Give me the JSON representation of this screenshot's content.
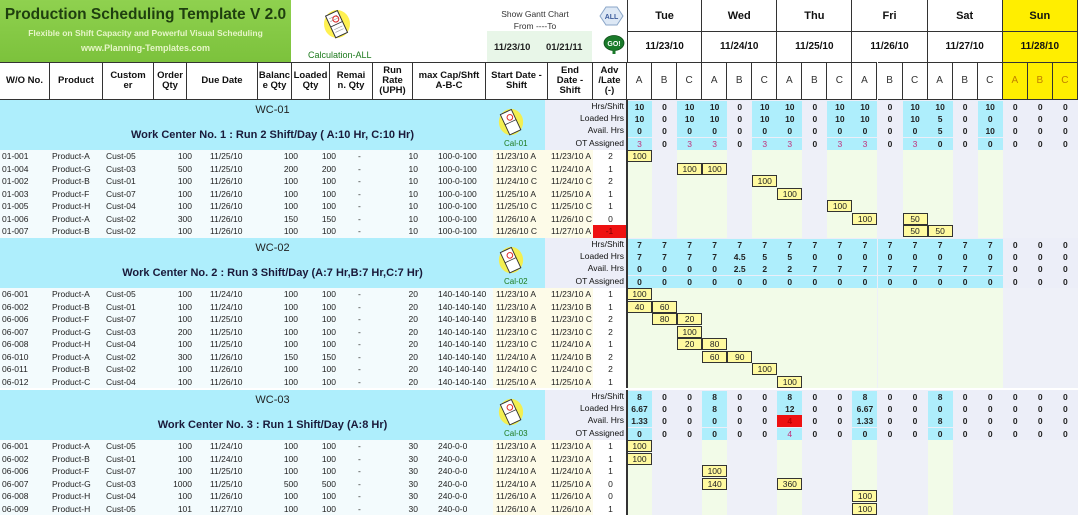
{
  "title": {
    "main": "Production Scheduling Template V 2.0",
    "subtitle": "Flexible on Shift Capacity and Powerful Visual Scheduling",
    "url": "www.Planning-Templates.com"
  },
  "calc_all_label": "Calculation-ALL",
  "gantt": {
    "label_line1": "Show Gantt Chart",
    "label_line2": "From ----To",
    "from": "11/23/10",
    "to": "01/21/11",
    "all_button": "ALL",
    "go_button": "GO!"
  },
  "columns": [
    "W/O No.",
    "Product",
    "Customer",
    "Order Qty",
    "Due Date",
    "Balance Qty",
    "Loaded Qty",
    "Remain. Qty",
    "Run Rate (UPH)",
    "max Cap/Shft A-B-C",
    "Start Date - Shift",
    "End Date - Shift",
    "Adv /Late (-)"
  ],
  "days": [
    {
      "day": "Tue",
      "date": "11/23/10",
      "weekend": false
    },
    {
      "day": "Wed",
      "date": "11/24/10",
      "weekend": false
    },
    {
      "day": "Thu",
      "date": "11/25/10",
      "weekend": false
    },
    {
      "day": "Fri",
      "date": "11/26/10",
      "weekend": false
    },
    {
      "day": "Sat",
      "date": "11/27/10",
      "weekend": false
    },
    {
      "day": "Sun",
      "date": "11/28/10",
      "weekend": true
    }
  ],
  "shifts": [
    "A",
    "B",
    "C"
  ],
  "summary_labels": [
    "Hrs/Shift",
    "Loaded Hrs",
    "Avail. Hrs",
    "OT Assigned"
  ],
  "work_centers": [
    {
      "id": "WC-01",
      "description": "Work Center No. 1 : Run 2 Shift/Day ( A:10 Hr, C:10 Hr)",
      "cal_label": "Cal-01",
      "summary": {
        "hrs_shift": [
          "10",
          "0",
          "10",
          "10",
          "0",
          "10",
          "10",
          "0",
          "10",
          "10",
          "0",
          "10",
          "10",
          "0",
          "10",
          "0",
          "0",
          "0"
        ],
        "loaded_hrs": [
          "10",
          "0",
          "10",
          "10",
          "0",
          "10",
          "10",
          "0",
          "10",
          "10",
          "0",
          "10",
          "5",
          "0",
          "0",
          "0",
          "0",
          "0"
        ],
        "avail_hrs": [
          "0",
          "0",
          "0",
          "0",
          "0",
          "0",
          "0",
          "0",
          "0",
          "0",
          "0",
          "0",
          "5",
          "0",
          "10",
          "0",
          "0",
          "0"
        ],
        "ot_assigned": [
          "3",
          "0",
          "3",
          "3",
          "0",
          "3",
          "3",
          "0",
          "3",
          "3",
          "0",
          "3",
          "0",
          "0",
          "0",
          "0",
          "0",
          "0"
        ]
      },
      "orders": [
        {
          "wo": "01-001",
          "product": "Product-A",
          "customer": "Cust-05",
          "order_qty": "100",
          "due": "11/25/10",
          "balance": "100",
          "loaded": "100",
          "remain": "-",
          "rate": "10",
          "cap": "100-0-100",
          "start": "11/23/10 A",
          "end": "11/23/10 A",
          "adv": "2",
          "late": false,
          "bars": [
            [
              0,
              "100"
            ]
          ]
        },
        {
          "wo": "01-004",
          "product": "Product-G",
          "customer": "Cust-03",
          "order_qty": "500",
          "due": "11/25/10",
          "balance": "200",
          "loaded": "200",
          "remain": "-",
          "rate": "10",
          "cap": "100-0-100",
          "start": "11/23/10 C",
          "end": "11/24/10 A",
          "adv": "1",
          "late": false,
          "bars": [
            [
              2,
              "100"
            ],
            [
              3,
              "100"
            ]
          ]
        },
        {
          "wo": "01-002",
          "product": "Product-B",
          "customer": "Cust-01",
          "order_qty": "100",
          "due": "11/26/10",
          "balance": "100",
          "loaded": "100",
          "remain": "-",
          "rate": "10",
          "cap": "100-0-100",
          "start": "11/24/10 C",
          "end": "11/24/10 C",
          "adv": "2",
          "late": false,
          "bars": [
            [
              5,
              "100"
            ]
          ]
        },
        {
          "wo": "01-003",
          "product": "Product-F",
          "customer": "Cust-07",
          "order_qty": "100",
          "due": "11/26/10",
          "balance": "100",
          "loaded": "100",
          "remain": "-",
          "rate": "10",
          "cap": "100-0-100",
          "start": "11/25/10 A",
          "end": "11/25/10 A",
          "adv": "1",
          "late": false,
          "bars": [
            [
              6,
              "100"
            ]
          ]
        },
        {
          "wo": "01-005",
          "product": "Product-H",
          "customer": "Cust-04",
          "order_qty": "100",
          "due": "11/26/10",
          "balance": "100",
          "loaded": "100",
          "remain": "-",
          "rate": "10",
          "cap": "100-0-100",
          "start": "11/25/10 C",
          "end": "11/25/10 C",
          "adv": "1",
          "late": false,
          "bars": [
            [
              8,
              "100"
            ]
          ]
        },
        {
          "wo": "01-006",
          "product": "Product-A",
          "customer": "Cust-02",
          "order_qty": "300",
          "due": "11/26/10",
          "balance": "150",
          "loaded": "150",
          "remain": "-",
          "rate": "10",
          "cap": "100-0-100",
          "start": "11/26/10 A",
          "end": "11/26/10 C",
          "adv": "0",
          "late": false,
          "bars": [
            [
              9,
              "100"
            ],
            [
              11,
              "50"
            ]
          ]
        },
        {
          "wo": "01-007",
          "product": "Product-B",
          "customer": "Cust-02",
          "order_qty": "100",
          "due": "11/26/10",
          "balance": "100",
          "loaded": "100",
          "remain": "-",
          "rate": "10",
          "cap": "100-0-100",
          "start": "11/26/10 C",
          "end": "11/27/10 A",
          "adv": "-1",
          "late": true,
          "bars": [
            [
              11,
              "50"
            ],
            [
              12,
              "50"
            ]
          ]
        }
      ]
    },
    {
      "id": "WC-02",
      "description": "Work Center No. 2 : Run 3 Shift/Day (A:7 Hr,B:7 Hr,C:7 Hr)",
      "cal_label": "Cal-02",
      "summary": {
        "hrs_shift": [
          "7",
          "7",
          "7",
          "7",
          "7",
          "7",
          "7",
          "7",
          "7",
          "7",
          "7",
          "7",
          "7",
          "7",
          "7",
          "0",
          "0",
          "0"
        ],
        "loaded_hrs": [
          "7",
          "7",
          "7",
          "7",
          "4.5",
          "5",
          "5",
          "0",
          "0",
          "0",
          "0",
          "0",
          "0",
          "0",
          "0",
          "0",
          "0",
          "0"
        ],
        "avail_hrs": [
          "0",
          "0",
          "0",
          "0",
          "2.5",
          "2",
          "2",
          "7",
          "7",
          "7",
          "7",
          "7",
          "7",
          "7",
          "7",
          "0",
          "0",
          "0"
        ],
        "ot_assigned": [
          "0",
          "0",
          "0",
          "0",
          "0",
          "0",
          "0",
          "0",
          "0",
          "0",
          "0",
          "0",
          "0",
          "0",
          "0",
          "0",
          "0",
          "0"
        ]
      },
      "orders": [
        {
          "wo": "06-001",
          "product": "Product-A",
          "customer": "Cust-05",
          "order_qty": "100",
          "due": "11/24/10",
          "balance": "100",
          "loaded": "100",
          "remain": "-",
          "rate": "20",
          "cap": "140-140-140",
          "start": "11/23/10 A",
          "end": "11/23/10 A",
          "adv": "1",
          "late": false,
          "bars": [
            [
              0,
              "100"
            ]
          ]
        },
        {
          "wo": "06-002",
          "product": "Product-B",
          "customer": "Cust-01",
          "order_qty": "100",
          "due": "11/24/10",
          "balance": "100",
          "loaded": "100",
          "remain": "-",
          "rate": "20",
          "cap": "140-140-140",
          "start": "11/23/10 A",
          "end": "11/23/10 B",
          "adv": "1",
          "late": false,
          "bars": [
            [
              0,
              "40"
            ],
            [
              1,
              "60"
            ]
          ]
        },
        {
          "wo": "06-006",
          "product": "Product-F",
          "customer": "Cust-07",
          "order_qty": "100",
          "due": "11/25/10",
          "balance": "100",
          "loaded": "100",
          "remain": "-",
          "rate": "20",
          "cap": "140-140-140",
          "start": "11/23/10 B",
          "end": "11/23/10 C",
          "adv": "2",
          "late": false,
          "bars": [
            [
              1,
              "80"
            ],
            [
              2,
              "20"
            ]
          ]
        },
        {
          "wo": "06-007",
          "product": "Product-G",
          "customer": "Cust-03",
          "order_qty": "200",
          "due": "11/25/10",
          "balance": "100",
          "loaded": "100",
          "remain": "-",
          "rate": "20",
          "cap": "140-140-140",
          "start": "11/23/10 C",
          "end": "11/23/10 C",
          "adv": "2",
          "late": false,
          "bars": [
            [
              2,
              "100"
            ]
          ]
        },
        {
          "wo": "06-008",
          "product": "Product-H",
          "customer": "Cust-04",
          "order_qty": "100",
          "due": "11/25/10",
          "balance": "100",
          "loaded": "100",
          "remain": "-",
          "rate": "20",
          "cap": "140-140-140",
          "start": "11/23/10 C",
          "end": "11/24/10 A",
          "adv": "1",
          "late": false,
          "bars": [
            [
              2,
              "20"
            ],
            [
              3,
              "80"
            ]
          ]
        },
        {
          "wo": "06-010",
          "product": "Product-A",
          "customer": "Cust-02",
          "order_qty": "300",
          "due": "11/26/10",
          "balance": "150",
          "loaded": "150",
          "remain": "-",
          "rate": "20",
          "cap": "140-140-140",
          "start": "11/24/10 A",
          "end": "11/24/10 B",
          "adv": "2",
          "late": false,
          "bars": [
            [
              3,
              "60"
            ],
            [
              4,
              "90"
            ]
          ]
        },
        {
          "wo": "06-011",
          "product": "Product-B",
          "customer": "Cust-02",
          "order_qty": "100",
          "due": "11/26/10",
          "balance": "100",
          "loaded": "100",
          "remain": "-",
          "rate": "20",
          "cap": "140-140-140",
          "start": "11/24/10 C",
          "end": "11/24/10 C",
          "adv": "2",
          "late": false,
          "bars": [
            [
              5,
              "100"
            ]
          ]
        },
        {
          "wo": "06-012",
          "product": "Product-C",
          "customer": "Cust-04",
          "order_qty": "100",
          "due": "11/26/10",
          "balance": "100",
          "loaded": "100",
          "remain": "-",
          "rate": "20",
          "cap": "140-140-140",
          "start": "11/25/10 A",
          "end": "11/25/10 A",
          "adv": "1",
          "late": false,
          "bars": [
            [
              6,
              "100"
            ]
          ]
        }
      ]
    },
    {
      "id": "WC-03",
      "description": "Work Center No. 3 : Run 1 Shift/Day (A:8 Hr)",
      "cal_label": "Cal-03",
      "summary": {
        "hrs_shift": [
          "8",
          "0",
          "0",
          "8",
          "0",
          "0",
          "8",
          "0",
          "0",
          "8",
          "0",
          "0",
          "8",
          "0",
          "0",
          "0",
          "0",
          "0"
        ],
        "loaded_hrs": [
          "6.67",
          "0",
          "0",
          "8",
          "0",
          "0",
          "12",
          "0",
          "0",
          "6.67",
          "0",
          "0",
          "0",
          "0",
          "0",
          "0",
          "0",
          "0"
        ],
        "avail_hrs": [
          "1.33",
          "0",
          "0",
          "0",
          "0",
          "0",
          "-4",
          "0",
          "0",
          "1.33",
          "0",
          "0",
          "8",
          "0",
          "0",
          "0",
          "0",
          "0"
        ],
        "ot_assigned": [
          "0",
          "0",
          "0",
          "0",
          "0",
          "0",
          "4",
          "0",
          "0",
          "0",
          "0",
          "0",
          "0",
          "0",
          "0",
          "0",
          "0",
          "0"
        ]
      },
      "orders": [
        {
          "wo": "06-001",
          "product": "Product-A",
          "customer": "Cust-05",
          "order_qty": "100",
          "due": "11/24/10",
          "balance": "100",
          "loaded": "100",
          "remain": "-",
          "rate": "30",
          "cap": "240-0-0",
          "start": "11/23/10 A",
          "end": "11/23/10 A",
          "adv": "1",
          "late": false,
          "bars": [
            [
              0,
              "100"
            ]
          ]
        },
        {
          "wo": "06-002",
          "product": "Product-B",
          "customer": "Cust-01",
          "order_qty": "100",
          "due": "11/24/10",
          "balance": "100",
          "loaded": "100",
          "remain": "-",
          "rate": "30",
          "cap": "240-0-0",
          "start": "11/23/10 A",
          "end": "11/23/10 A",
          "adv": "1",
          "late": false,
          "bars": [
            [
              0,
              "100"
            ]
          ]
        },
        {
          "wo": "06-006",
          "product": "Product-F",
          "customer": "Cust-07",
          "order_qty": "100",
          "due": "11/25/10",
          "balance": "100",
          "loaded": "100",
          "remain": "-",
          "rate": "30",
          "cap": "240-0-0",
          "start": "11/24/10 A",
          "end": "11/24/10 A",
          "adv": "1",
          "late": false,
          "bars": [
            [
              3,
              "100"
            ]
          ]
        },
        {
          "wo": "06-007",
          "product": "Product-G",
          "customer": "Cust-03",
          "order_qty": "1000",
          "due": "11/25/10",
          "balance": "500",
          "loaded": "500",
          "remain": "-",
          "rate": "30",
          "cap": "240-0-0",
          "start": "11/24/10 A",
          "end": "11/25/10 A",
          "adv": "0",
          "late": false,
          "bars": [
            [
              3,
              "140"
            ],
            [
              6,
              "360"
            ]
          ]
        },
        {
          "wo": "06-008",
          "product": "Product-H",
          "customer": "Cust-04",
          "order_qty": "100",
          "due": "11/26/10",
          "balance": "100",
          "loaded": "100",
          "remain": "-",
          "rate": "30",
          "cap": "240-0-0",
          "start": "11/26/10 A",
          "end": "11/26/10 A",
          "adv": "0",
          "late": false,
          "bars": [
            [
              9,
              "100"
            ]
          ]
        },
        {
          "wo": "06-009",
          "product": "Product-H",
          "customer": "Cust-05",
          "order_qty": "101",
          "due": "11/27/10",
          "balance": "100",
          "loaded": "100",
          "remain": "-",
          "rate": "30",
          "cap": "240-0-0",
          "start": "11/26/10 A",
          "end": "11/26/10 A",
          "adv": "1",
          "late": false,
          "bars": [
            [
              9,
              "100"
            ]
          ]
        }
      ]
    }
  ]
}
